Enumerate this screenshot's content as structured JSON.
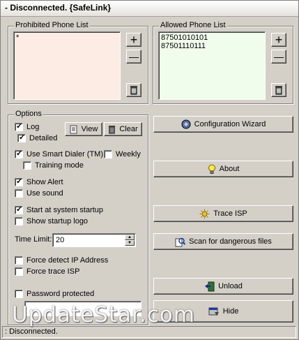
{
  "window": {
    "title": "- Disconnected. {SafeLink}"
  },
  "prohibited": {
    "label": "Prohibited Phone List",
    "items": [
      "*"
    ]
  },
  "allowed": {
    "label": "Allowed Phone List",
    "items": [
      "87501010101",
      "87501110111"
    ]
  },
  "list_buttons": {
    "add": "+",
    "remove": "—"
  },
  "options": {
    "label": "Options",
    "log": "Log",
    "detailed": "Detailed",
    "view": "View",
    "clear": "Clear",
    "smart_dialer": "Use Smart Dialer (TM)",
    "weekly": "Weekly",
    "training_mode": "Training mode",
    "show_alert": "Show Alert",
    "use_sound": "Use sound",
    "start_startup": "Start at system startup",
    "show_logo": "Show startup logo",
    "time_limit_label": "Time Limit:",
    "time_limit_value": "20",
    "force_detect": "Force detect IP Address",
    "force_trace": "Force trace ISP",
    "password": "Password protected"
  },
  "actions": {
    "config_wizard": "Configuration Wizard",
    "about": "About",
    "trace_isp": "Trace ISP",
    "scan": "Scan for dangerous files",
    "unload": "Unload",
    "hide": "Hide"
  },
  "status": {
    "text": ": Disconnected."
  },
  "watermark": "UpdateStar.com",
  "colors": {
    "prohibited_bg": "#fcece4",
    "allowed_bg": "#f0fcec",
    "face": "#d4d0c8"
  }
}
